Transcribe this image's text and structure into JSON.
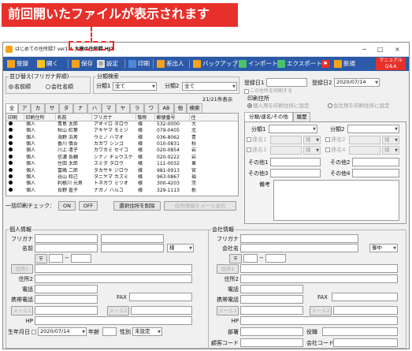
{
  "annotation": {
    "banner_text": "前回開いたファイルが表示されます"
  },
  "window": {
    "title": "はじめての住所録7 ver1.4",
    "file_name": "- 大樹の住所録.HJ7",
    "controls": [
      "−",
      "□",
      "×"
    ]
  },
  "toolbar": {
    "items": [
      {
        "label": "登録",
        "icon": "register-icon",
        "color": "#f6a21c"
      },
      {
        "label": "開く",
        "icon": "open-folder-icon",
        "color": "#f6c21c"
      },
      {
        "label": "保存",
        "icon": "save-icon",
        "color": "#f6a21c"
      },
      {
        "label": "設定",
        "icon": "gear-icon",
        "color": "#dddddd"
      },
      {
        "label": "印刷",
        "icon": "printer-icon",
        "color": "#4a8ad8"
      },
      {
        "label": "差出人",
        "icon": "sender-icon",
        "color": "#f6a21c"
      },
      {
        "label": "バックアップ",
        "icon": "backup-icon",
        "color": "#f6a21c"
      },
      {
        "label": "インポート",
        "icon": "import-icon",
        "color": "#4ac26a"
      },
      {
        "label": "エクスポート",
        "icon": "export-icon",
        "color": "#4ac26a"
      },
      {
        "label": "",
        "icon": "flag-icon",
        "color": "#e8302a"
      },
      {
        "label": "新規",
        "icon": "new-icon",
        "color": "#f6a21c"
      }
    ],
    "manual_label": "マニュアル",
    "qa_label": "Q＆A"
  },
  "sort": {
    "title": "並び替え(フリガナ昇順)",
    "options": [
      "名前順",
      "会社名順"
    ],
    "selected": "名前順"
  },
  "category_search": {
    "title": "分類検索",
    "label1": "分類1",
    "value1": "全て",
    "label2": "分類2",
    "value2": "全て"
  },
  "record_count": "21/21件表示",
  "index_tabs": [
    "全",
    "ア",
    "カ",
    "サ",
    "タ",
    "ナ",
    "ハ",
    "マ",
    "ヤ",
    "ラ",
    "ワ",
    "AB",
    "他",
    "検索"
  ],
  "list": {
    "columns": [
      "印刷",
      "印刷住所",
      "名前",
      "フリガナ",
      "敬称",
      "郵便番号",
      "住"
    ],
    "rows": [
      {
        "addr": "個人",
        "name": "青島 太郎",
        "kana": "アオイロ タロウ",
        "title": "様",
        "zip": "532-0000",
        "x": "大"
      },
      {
        "addr": "個人",
        "name": "秋山 紅葉",
        "kana": "アキヤマ モミジ",
        "title": "様",
        "zip": "079-0405",
        "x": "北"
      },
      {
        "addr": "個人",
        "name": "海野 浜男",
        "kana": "ウミノ ハマオ",
        "title": "様",
        "zip": "036-8062",
        "x": "青"
      },
      {
        "addr": "個人",
        "name": "香川 慎吾",
        "kana": "カガワ シンゴ",
        "title": "様",
        "zip": "010-0831",
        "x": "秋"
      },
      {
        "addr": "個人",
        "name": "川上 清子",
        "kana": "カワカミ セイコ",
        "title": "様",
        "zip": "020-0854",
        "x": "岩"
      },
      {
        "addr": "個人",
        "name": "信濃 長輔",
        "kana": "シナノ チョウスケ",
        "title": "様",
        "zip": "020-0222",
        "x": "岩"
      },
      {
        "addr": "個人",
        "name": "住田 太郎",
        "kana": "スミダ タロウ",
        "title": "様",
        "zip": "111-0032",
        "x": "東"
      },
      {
        "addr": "個人",
        "name": "富嶋 二郎",
        "kana": "タカサキ ジロウ",
        "title": "様",
        "zip": "981-0913",
        "x": "宮"
      },
      {
        "addr": "個人",
        "name": "谷山 和己",
        "kana": "タニヤマ カズミ",
        "title": "様",
        "zip": "963-0867",
        "x": "福"
      },
      {
        "addr": "個人",
        "name": "利根川 元男",
        "kana": "トネガワ ミツオ",
        "title": "様",
        "zip": "300-4203",
        "x": "茨"
      },
      {
        "addr": "個人",
        "name": "長野 直子",
        "kana": "ナガノ ハルコ",
        "title": "様",
        "zip": "329-1113",
        "x": "栃"
      }
    ]
  },
  "bulk_print": {
    "label": "一括印刷チェック：",
    "on": "ON",
    "off": "OFF",
    "delete_selected": "選択住所を削除",
    "mail_send": "住所情報をメール送信"
  },
  "registration": {
    "date1_label": "登録日1",
    "date2_label": "登録日2",
    "date2_value": "2020/07/14",
    "input_note": "この住所を印刷する",
    "print_addr_title": "印刷住所",
    "print_opt1": "個人用を印刷住所に設定",
    "print_opt2": "会社用を印刷住所に設定"
  },
  "detail_tabs": [
    "分類/連名/その他",
    "履歴"
  ],
  "detail": {
    "cat1": "分類1",
    "cat2": "分類2",
    "ren1": "連名1",
    "ren2": "連名2",
    "ren3": "連名3",
    "ren4": "連名4",
    "honorific": "様",
    "other1": "その他1",
    "other2": "その他2",
    "other3": "その他3",
    "other4": "その他4",
    "remarks": "備考"
  },
  "personal": {
    "title": "個人情報",
    "furigana": "フリガナ",
    "name": "名前",
    "honorific": "様",
    "zip": "〒",
    "address1": "住所1",
    "address2": "住所2",
    "phone": "電話",
    "mobile": "携帯電話",
    "fax": "FAX",
    "mail1": "メール1",
    "mail2": "メール2",
    "hp": "HP",
    "birthday": "生年月日",
    "birthday_value": "2020/07/14",
    "age": "年齢",
    "gender": "性別",
    "gender_value": "未設定"
  },
  "company": {
    "title": "会社情報",
    "furigana": "フリガナ",
    "company_name": "会社名",
    "honorific": "御中",
    "zip": "〒",
    "address1": "住所1",
    "address2": "住所2",
    "phone": "電話",
    "mobile": "携帯電話",
    "fax": "FAX",
    "mail1": "メール1",
    "mail2": "メール2",
    "hp": "HP",
    "dept": "部署",
    "position": "役職",
    "code": "顧客コード",
    "company_code": "会社コード"
  }
}
